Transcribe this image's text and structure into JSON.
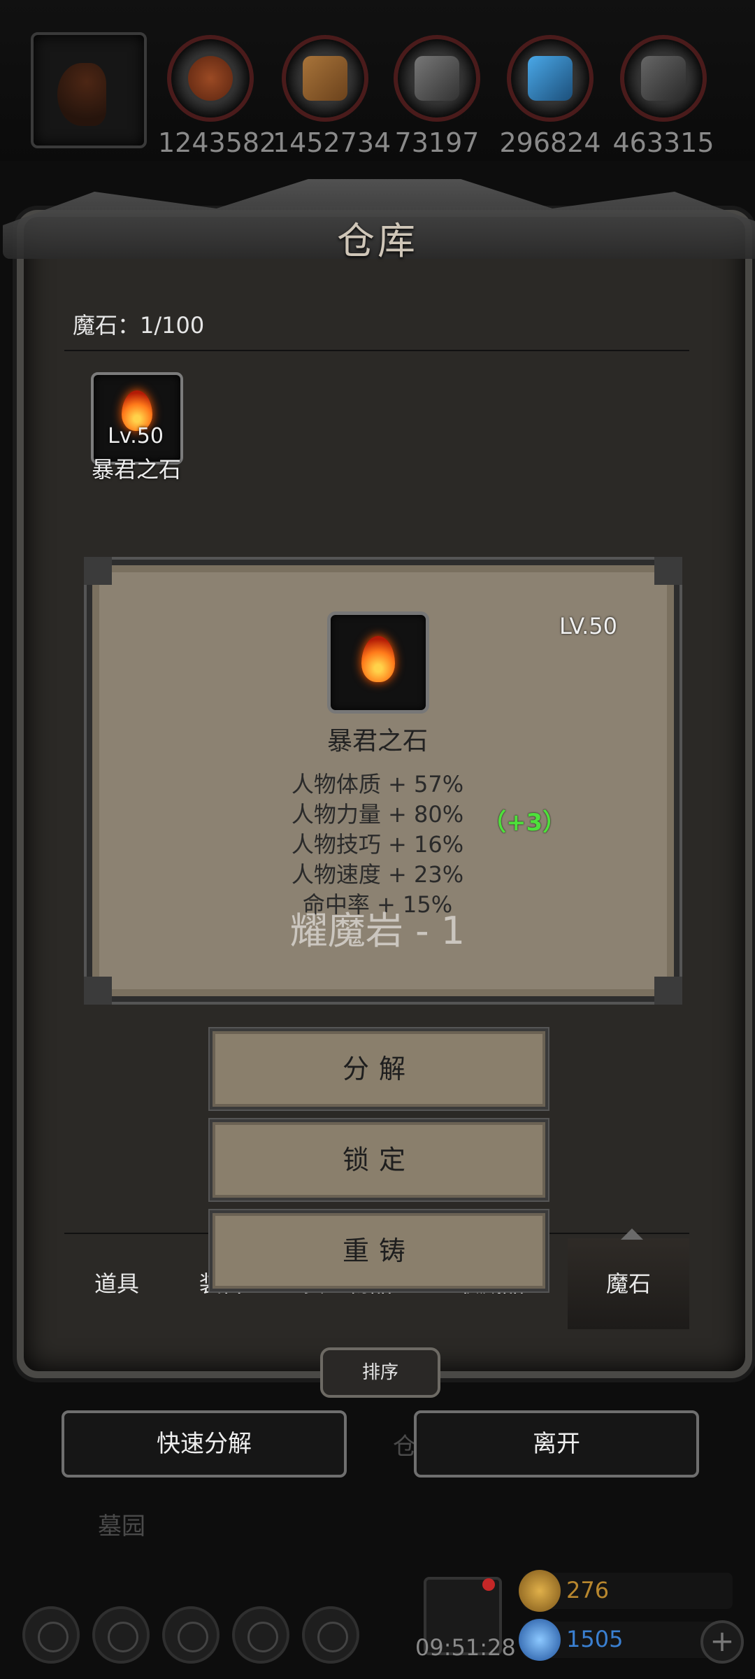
{
  "top_bar": {
    "resources": [
      {
        "name": "meat",
        "value": "1243582",
        "color": "#8a3a1e"
      },
      {
        "name": "wood",
        "value": "1452734",
        "color": "#8b5a2b"
      },
      {
        "name": "iron",
        "value": "73197",
        "color": "#555555"
      },
      {
        "name": "crystal",
        "value": "296824",
        "color": "#2f6fa8"
      },
      {
        "name": "stone",
        "value": "463315",
        "color": "#4a4a4a"
      }
    ]
  },
  "panel": {
    "title": "仓库",
    "count_label": "魔石：1/100",
    "item": {
      "level": "Lv.50",
      "name": "暴君之石"
    }
  },
  "detail": {
    "level": "LV.50",
    "name": "暴君之石",
    "stats": [
      "人物体质 + 57%",
      "人物力量 + 80%",
      "人物技巧 + 16%",
      "人物速度 + 23%",
      "命中率 + 15%"
    ],
    "bonus": "（+3）",
    "overlay": "耀魔岩 - 1"
  },
  "actions": {
    "decompose": "分解",
    "lock": "锁定",
    "reforge": "重铸"
  },
  "tabs": [
    {
      "label": "道具",
      "active": false
    },
    {
      "label": "装备",
      "active": false
    },
    {
      "label": "贵重物品",
      "active": false
    },
    {
      "label": "收藏品",
      "active": false
    },
    {
      "label": "魔石",
      "active": true
    }
  ],
  "sort_label": "排序",
  "bottom": {
    "quick_decompose": "快速分解",
    "leave": "离开",
    "bg_label_1": "仓",
    "bg_label_2": "墓园"
  },
  "hud": {
    "time": "09:51:28",
    "gold": "276",
    "gems": "1505",
    "accent_gold": "#b8872e",
    "accent_blue": "#3a7fd0",
    "icons": [
      "settings-icon",
      "guild-icon",
      "rank-icon",
      "mail-icon",
      "shop-icon"
    ]
  }
}
